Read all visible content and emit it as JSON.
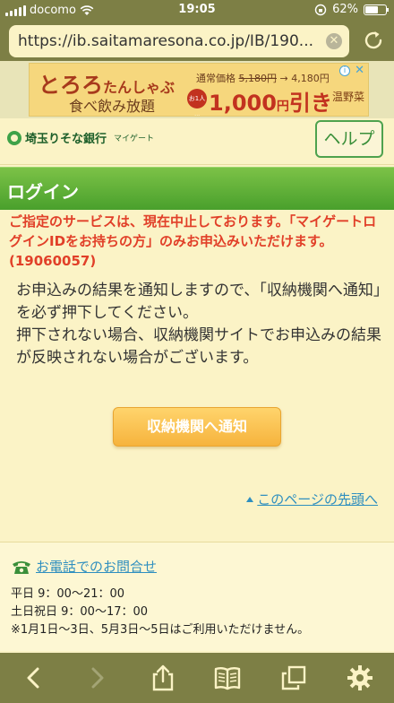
{
  "status_bar": {
    "carrier": "docomo",
    "time": "19:05",
    "battery_percent": "62%",
    "battery_level": 0.62
  },
  "browser": {
    "url": "https://ib.saitamaresona.co.jp/IB/190...",
    "clear_icon": "close-circle-icon",
    "reload_icon": "reload-icon"
  },
  "ad": {
    "headline_part1": "とろろ",
    "headline_part2": "たんしゃぶ",
    "subline": "食べ飲み放題",
    "price_label": "通常価格",
    "price_before": "5,180円",
    "price_arrow": "→",
    "price_after": "4,180円",
    "per_person": "お1人様",
    "discount_amount": "1,000",
    "discount_unit": "円",
    "discount_suffix": "引き",
    "brand": "温野菜",
    "info_glyph": "i",
    "close_glyph": "✕"
  },
  "header": {
    "logo_name": "埼玉りそな銀行",
    "logo_sub": "マイゲート",
    "help_label": "ヘルプ"
  },
  "section": {
    "title": "ログイン"
  },
  "main": {
    "error_message": "ご指定のサービスは、現在中止しております。「マイゲートログインIDをお持ちの方」のみお申込みいただけます。(19060057)",
    "info_message_1": "お申込みの結果を通知しますので、「収納機関へ通知」を必ず押下してください。",
    "info_message_2": "押下されない場合、収納機関サイトでお申込みの結果が反映されない場合がございます。",
    "notify_button": "収納機関へ通知",
    "back_to_top": "このページの先頭へ"
  },
  "contact": {
    "phone_link": "お電話でのお問合せ",
    "weekday_hours": "平日 9：00〜21：00",
    "weekend_hours": "土日祝日 9：00〜17：00",
    "closed_note": "※1月1日〜3日、5月3日〜5日はご利用いただけません。"
  },
  "colors": {
    "browser_chrome": "#7d7f45",
    "page_background": "#fbf3c6",
    "section_green": "#49a02c",
    "error_red": "#e13f28",
    "button_orange": "#f6b33d",
    "link_blue": "#2f8fbf"
  }
}
